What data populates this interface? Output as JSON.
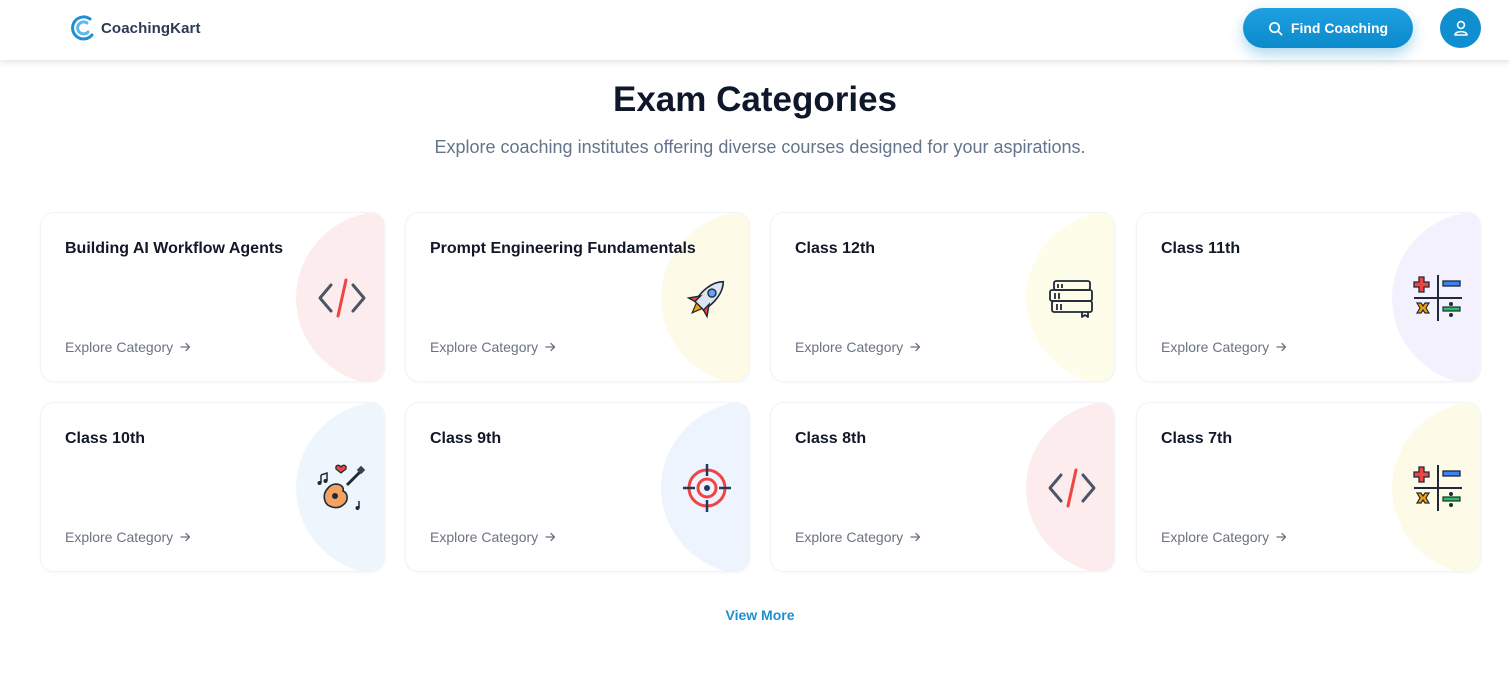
{
  "header": {
    "logo_text": "CoachingKart",
    "find_button_label": "Find Coaching",
    "search_icon": "search-icon",
    "user_icon": "user-icon"
  },
  "main": {
    "title": "Exam Categories",
    "subtitle": "Explore coaching institutes offering diverse courses designed for your aspirations.",
    "view_more_label": "View More",
    "categories": [
      {
        "title": "Building AI Workflow Agents",
        "link": "Explore Category",
        "icon": "code-icon",
        "blob_color": "#fdecee"
      },
      {
        "title": "Prompt Engineering Fundamentals",
        "link": "Explore Category",
        "icon": "rocket-icon",
        "blob_color": "#fdfbe8"
      },
      {
        "title": "Class 12th",
        "link": "Explore Category",
        "icon": "books-icon",
        "blob_color": "#fdfde9"
      },
      {
        "title": "Class 11th",
        "link": "Explore Category",
        "icon": "math-symbols-icon",
        "blob_color": "#f3f1fd"
      },
      {
        "title": "Class 10th",
        "link": "Explore Category",
        "icon": "guitar-icon",
        "blob_color": "#eef6fd"
      },
      {
        "title": "Class 9th",
        "link": "Explore Category",
        "icon": "target-icon",
        "blob_color": "#eef4fd"
      },
      {
        "title": "Class 8th",
        "link": "Explore Category",
        "icon": "code-icon",
        "blob_color": "#fdecee"
      },
      {
        "title": "Class 7th",
        "link": "Explore Category",
        "icon": "math-symbols-icon",
        "blob_color": "#fdfbe8"
      }
    ]
  },
  "colors": {
    "accent": "#0f8fd0",
    "link": "#1d8fcf",
    "muted_text": "#64748b"
  }
}
